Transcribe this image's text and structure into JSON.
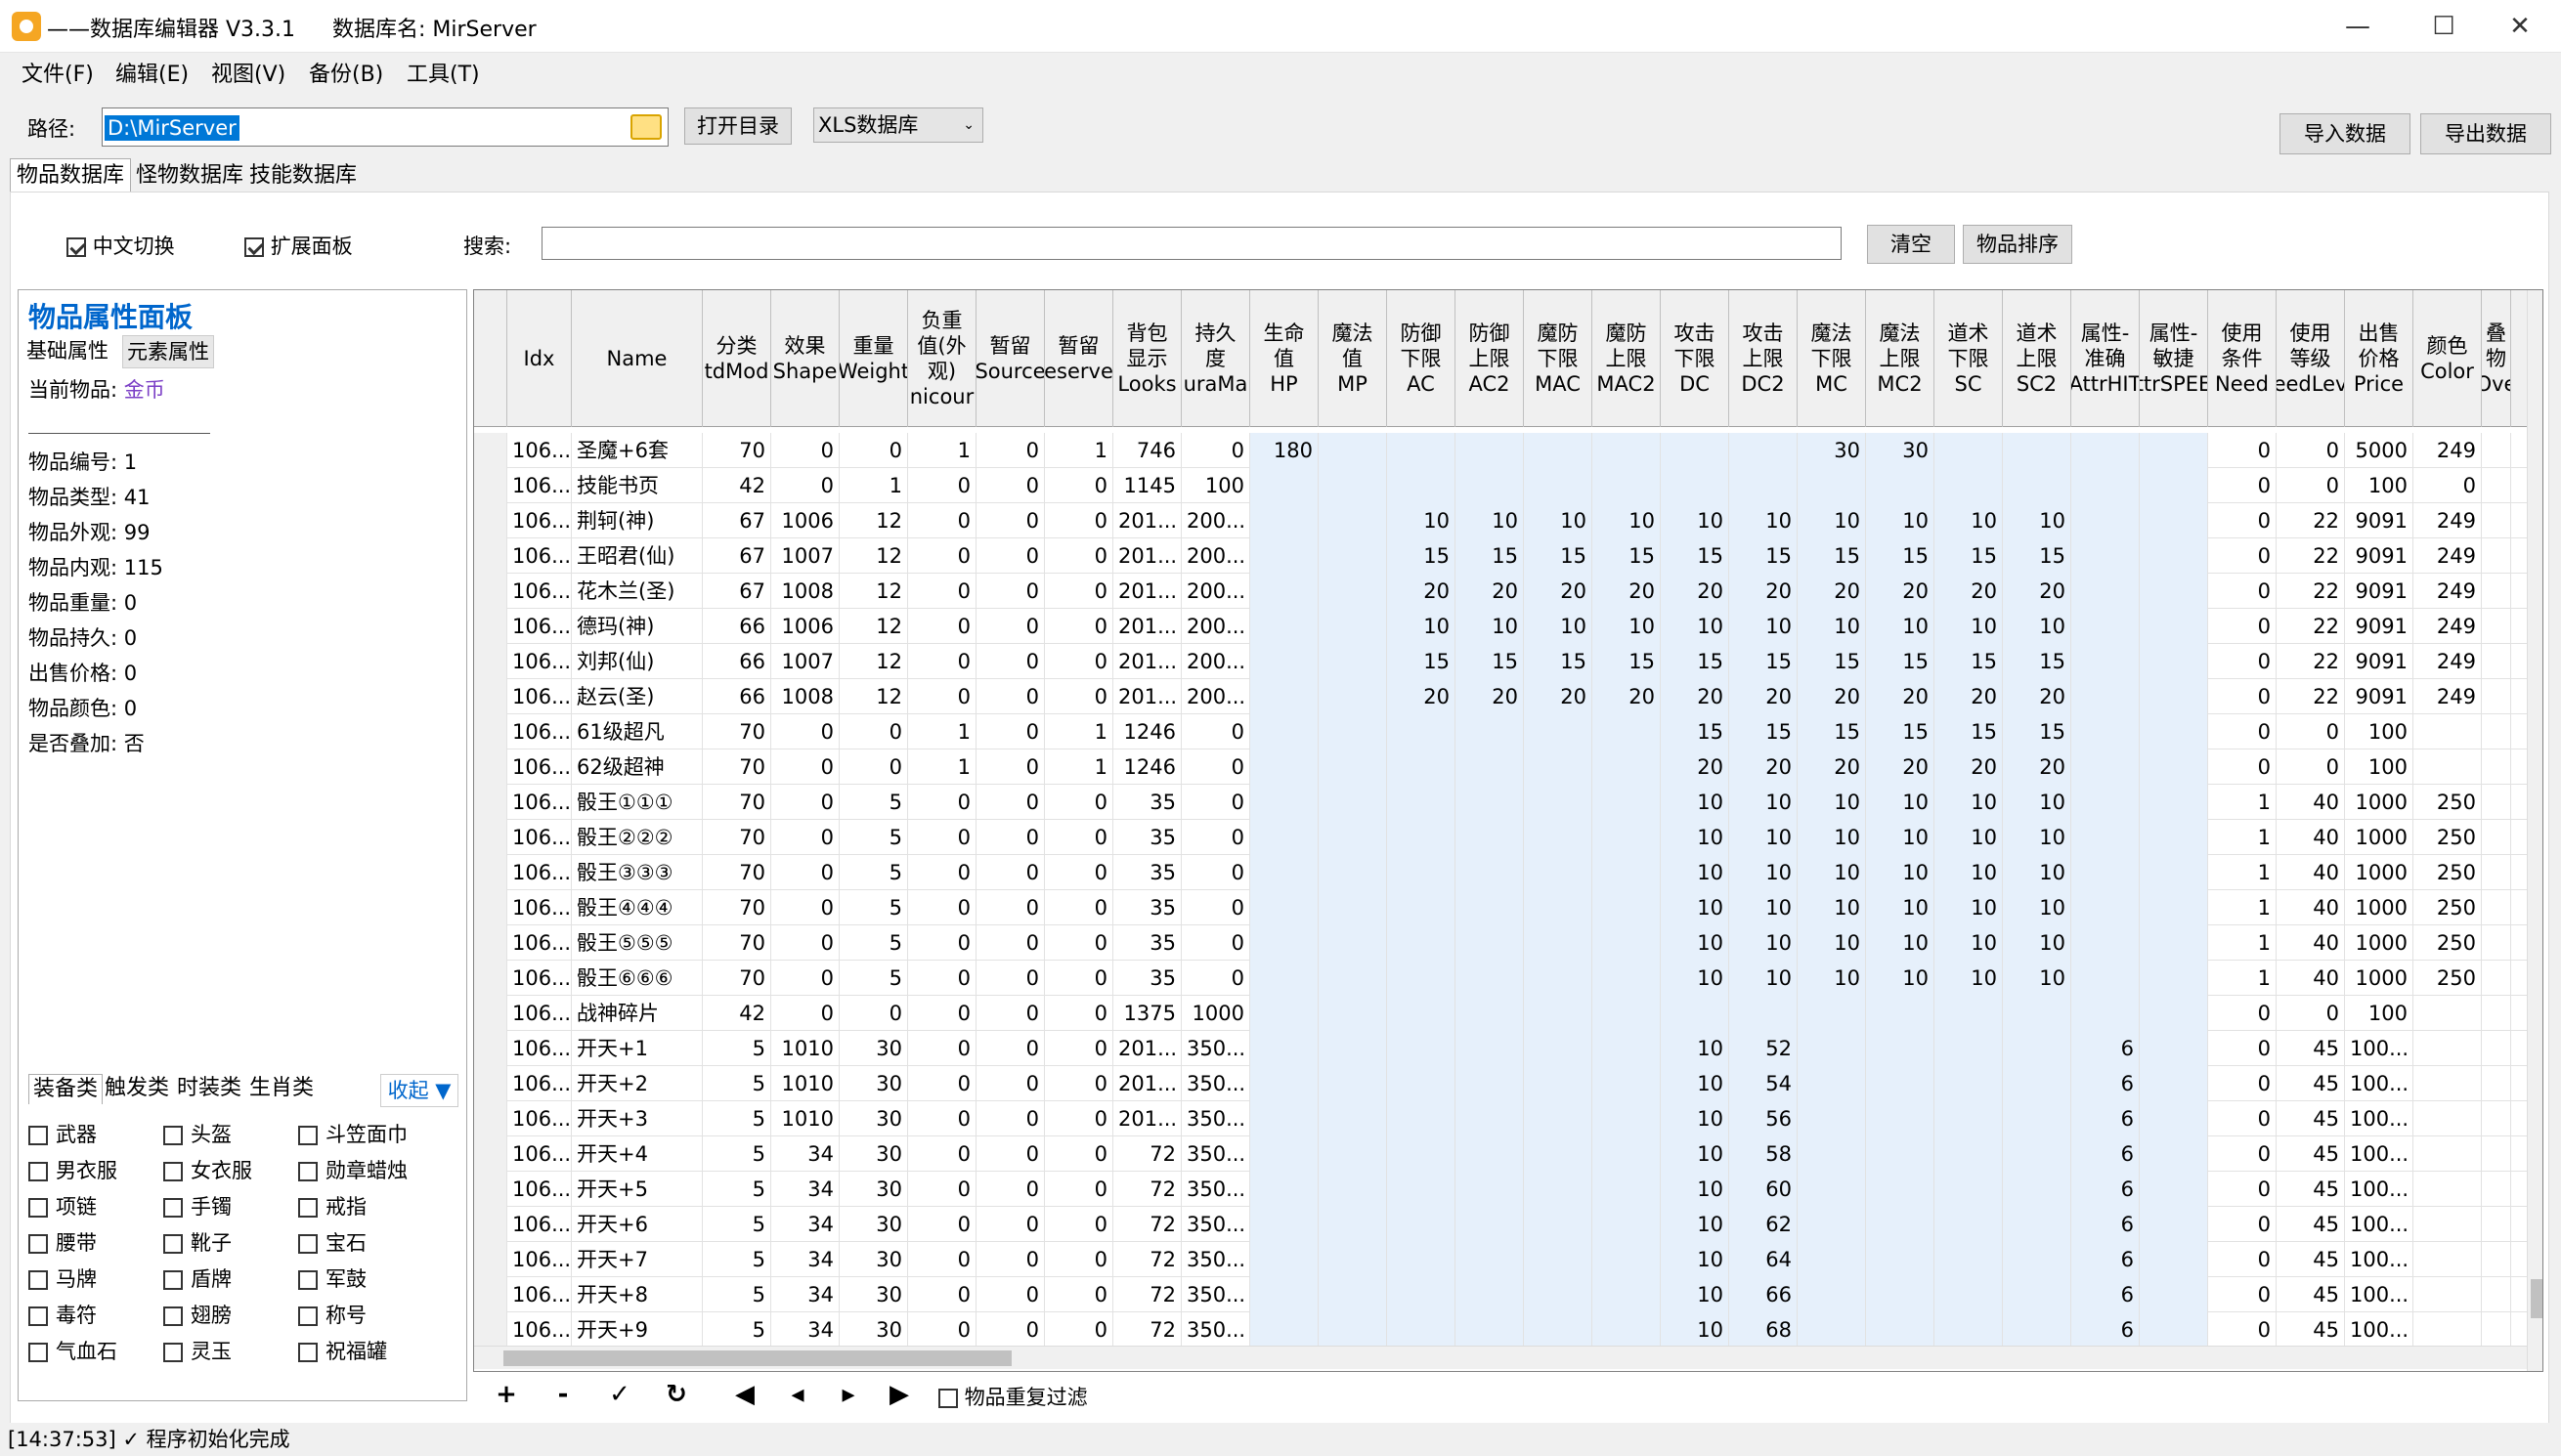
{
  "window": {
    "title": "——数据库编辑器 V3.3.1",
    "db_label": "数据库名: MirServer",
    "minimize": "—",
    "maximize": "☐",
    "close": "✕"
  },
  "menu": [
    "文件(F)",
    "编辑(E)",
    "视图(V)",
    "备份(B)",
    "工具(T)"
  ],
  "toolbar": {
    "path_label": "路径:",
    "path_value": "D:\\MirServer",
    "open_dir": "打开目录",
    "db_type": "XLS数据库",
    "import": "导入数据",
    "export": "导出数据"
  },
  "tabs": [
    "物品数据库",
    "怪物数据库",
    "技能数据库"
  ],
  "options": {
    "chinese_switch": "中文切换",
    "expand_panel": "扩展面板",
    "search_label": "搜索:",
    "search_value": "",
    "clear": "清空",
    "sort": "物品排序"
  },
  "panel": {
    "title": "物品属性面板",
    "subtab_basic": "基础属性",
    "subtab_element": "元素属性",
    "current_label": "当前物品:",
    "current_value": "金币",
    "props": [
      "物品编号: 1",
      "物品类型: 41",
      "物品外观: 99",
      "物品内观: 115",
      "物品重量: 0",
      "物品持久: 0",
      "出售价格: 0",
      "物品颜色: 0",
      "是否叠加: 否"
    ]
  },
  "categories": {
    "tabs": [
      "装备类",
      "触发类",
      "时装类",
      "生肖类"
    ],
    "collapse": "收起 ▼",
    "items": [
      "武器",
      "头盔",
      "斗笠面巾",
      "男衣服",
      "女衣服",
      "勋章蜡烛",
      "项链",
      "手镯",
      "戒指",
      "腰带",
      "靴子",
      "宝石",
      "马牌",
      "盾牌",
      "军鼓",
      "毒符",
      "翅膀",
      "称号",
      "气血石",
      "灵玉",
      "祝福罐"
    ]
  },
  "grid": {
    "headers": [
      "Idx",
      "Name",
      "分类\ntdMod",
      "效果\nShape",
      "重量\nWeight",
      "负重\n值(外\n观)\nnicour",
      "暂留\nSource",
      "暂留\neserve",
      "背包\n显示\nLooks",
      "持久\n度\nuraMa",
      "生命\n值\nHP",
      "魔法\n值\nMP",
      "防御\n下限\nAC",
      "防御\n上限\nAC2",
      "魔防\n下限\nMAC",
      "魔防\n上限\nMAC2",
      "攻击\n下限\nDC",
      "攻击\n上限\nDC2",
      "魔法\n下限\nMC",
      "魔法\n上限\nMC2",
      "道术\n下限\nSC",
      "道术\n上限\nSC2",
      "属性-\n准确\nAttrHIT",
      "属性-\n敏捷\nttrSPEE",
      "使用\n条件\nNeed",
      "使用\n等级\needLev",
      "出售\n价格\nPrice",
      "颜色\nColor",
      "叠\n物\nOve"
    ],
    "rows": [
      [
        "106...",
        "圣魔+6套",
        "70",
        "0",
        "0",
        "1",
        "0",
        "1",
        "746",
        "0",
        "180",
        "",
        "",
        "",
        "",
        "",
        "",
        "",
        "30",
        "30",
        "",
        "",
        "",
        "",
        "0",
        "0",
        "5000",
        "249",
        ""
      ],
      [
        "106...",
        "技能书页",
        "42",
        "0",
        "1",
        "0",
        "0",
        "0",
        "1145",
        "100",
        "",
        "",
        "",
        "",
        "",
        "",
        "",
        "",
        "",
        "",
        "",
        "",
        "",
        "",
        "0",
        "0",
        "100",
        "0",
        ""
      ],
      [
        "106...",
        "荆轲(神)",
        "67",
        "1006",
        "12",
        "0",
        "0",
        "0",
        "201...",
        "200...",
        "",
        "",
        "10",
        "10",
        "10",
        "10",
        "10",
        "10",
        "10",
        "10",
        "10",
        "10",
        "",
        "",
        "0",
        "22",
        "9091",
        "249",
        ""
      ],
      [
        "106...",
        "王昭君(仙)",
        "67",
        "1007",
        "12",
        "0",
        "0",
        "0",
        "201...",
        "200...",
        "",
        "",
        "15",
        "15",
        "15",
        "15",
        "15",
        "15",
        "15",
        "15",
        "15",
        "15",
        "",
        "",
        "0",
        "22",
        "9091",
        "249",
        ""
      ],
      [
        "106...",
        "花木兰(圣)",
        "67",
        "1008",
        "12",
        "0",
        "0",
        "0",
        "201...",
        "200...",
        "",
        "",
        "20",
        "20",
        "20",
        "20",
        "20",
        "20",
        "20",
        "20",
        "20",
        "20",
        "",
        "",
        "0",
        "22",
        "9091",
        "249",
        ""
      ],
      [
        "106...",
        "德玛(神)",
        "66",
        "1006",
        "12",
        "0",
        "0",
        "0",
        "201...",
        "200...",
        "",
        "",
        "10",
        "10",
        "10",
        "10",
        "10",
        "10",
        "10",
        "10",
        "10",
        "10",
        "",
        "",
        "0",
        "22",
        "9091",
        "249",
        ""
      ],
      [
        "106...",
        "刘邦(仙)",
        "66",
        "1007",
        "12",
        "0",
        "0",
        "0",
        "201...",
        "200...",
        "",
        "",
        "15",
        "15",
        "15",
        "15",
        "15",
        "15",
        "15",
        "15",
        "15",
        "15",
        "",
        "",
        "0",
        "22",
        "9091",
        "249",
        ""
      ],
      [
        "106...",
        "赵云(圣)",
        "66",
        "1008",
        "12",
        "0",
        "0",
        "0",
        "201...",
        "200...",
        "",
        "",
        "20",
        "20",
        "20",
        "20",
        "20",
        "20",
        "20",
        "20",
        "20",
        "20",
        "",
        "",
        "0",
        "22",
        "9091",
        "249",
        ""
      ],
      [
        "106...",
        "61级超凡",
        "70",
        "0",
        "0",
        "1",
        "0",
        "1",
        "1246",
        "0",
        "",
        "",
        "",
        "",
        "",
        "",
        "15",
        "15",
        "15",
        "15",
        "15",
        "15",
        "",
        "",
        "0",
        "0",
        "100",
        "",
        ""
      ],
      [
        "106...",
        "62级超神",
        "70",
        "0",
        "0",
        "1",
        "0",
        "1",
        "1246",
        "0",
        "",
        "",
        "",
        "",
        "",
        "",
        "20",
        "20",
        "20",
        "20",
        "20",
        "20",
        "",
        "",
        "0",
        "0",
        "100",
        "",
        ""
      ],
      [
        "106...",
        "骰王①①①",
        "70",
        "0",
        "5",
        "0",
        "0",
        "0",
        "35",
        "0",
        "",
        "",
        "",
        "",
        "",
        "",
        "10",
        "10",
        "10",
        "10",
        "10",
        "10",
        "",
        "",
        "1",
        "40",
        "1000",
        "250",
        ""
      ],
      [
        "106...",
        "骰王②②②",
        "70",
        "0",
        "5",
        "0",
        "0",
        "0",
        "35",
        "0",
        "",
        "",
        "",
        "",
        "",
        "",
        "10",
        "10",
        "10",
        "10",
        "10",
        "10",
        "",
        "",
        "1",
        "40",
        "1000",
        "250",
        ""
      ],
      [
        "106...",
        "骰王③③③",
        "70",
        "0",
        "5",
        "0",
        "0",
        "0",
        "35",
        "0",
        "",
        "",
        "",
        "",
        "",
        "",
        "10",
        "10",
        "10",
        "10",
        "10",
        "10",
        "",
        "",
        "1",
        "40",
        "1000",
        "250",
        ""
      ],
      [
        "106...",
        "骰王④④④",
        "70",
        "0",
        "5",
        "0",
        "0",
        "0",
        "35",
        "0",
        "",
        "",
        "",
        "",
        "",
        "",
        "10",
        "10",
        "10",
        "10",
        "10",
        "10",
        "",
        "",
        "1",
        "40",
        "1000",
        "250",
        ""
      ],
      [
        "106...",
        "骰王⑤⑤⑤",
        "70",
        "0",
        "5",
        "0",
        "0",
        "0",
        "35",
        "0",
        "",
        "",
        "",
        "",
        "",
        "",
        "10",
        "10",
        "10",
        "10",
        "10",
        "10",
        "",
        "",
        "1",
        "40",
        "1000",
        "250",
        ""
      ],
      [
        "106...",
        "骰王⑥⑥⑥",
        "70",
        "0",
        "5",
        "0",
        "0",
        "0",
        "35",
        "0",
        "",
        "",
        "",
        "",
        "",
        "",
        "10",
        "10",
        "10",
        "10",
        "10",
        "10",
        "",
        "",
        "1",
        "40",
        "1000",
        "250",
        ""
      ],
      [
        "106...",
        "战神碎片",
        "42",
        "0",
        "0",
        "0",
        "0",
        "0",
        "1375",
        "1000",
        "",
        "",
        "",
        "",
        "",
        "",
        "",
        "",
        "",
        "",
        "",
        "",
        "",
        "",
        "0",
        "0",
        "100",
        "",
        ""
      ],
      [
        "106...",
        "开天+1",
        "5",
        "1010",
        "30",
        "0",
        "0",
        "0",
        "201...",
        "350...",
        "",
        "",
        "",
        "",
        "",
        "",
        "10",
        "52",
        "",
        "",
        "",
        "",
        "6",
        "",
        "0",
        "45",
        "100...",
        "",
        ""
      ],
      [
        "106...",
        "开天+2",
        "5",
        "1010",
        "30",
        "0",
        "0",
        "0",
        "201...",
        "350...",
        "",
        "",
        "",
        "",
        "",
        "",
        "10",
        "54",
        "",
        "",
        "",
        "",
        "6",
        "",
        "0",
        "45",
        "100...",
        "",
        ""
      ],
      [
        "106...",
        "开天+3",
        "5",
        "1010",
        "30",
        "0",
        "0",
        "0",
        "201...",
        "350...",
        "",
        "",
        "",
        "",
        "",
        "",
        "10",
        "56",
        "",
        "",
        "",
        "",
        "6",
        "",
        "0",
        "45",
        "100...",
        "",
        ""
      ],
      [
        "106...",
        "开天+4",
        "5",
        "34",
        "30",
        "0",
        "0",
        "0",
        "72",
        "350...",
        "",
        "",
        "",
        "",
        "",
        "",
        "10",
        "58",
        "",
        "",
        "",
        "",
        "6",
        "",
        "0",
        "45",
        "100...",
        "",
        ""
      ],
      [
        "106...",
        "开天+5",
        "5",
        "34",
        "30",
        "0",
        "0",
        "0",
        "72",
        "350...",
        "",
        "",
        "",
        "",
        "",
        "",
        "10",
        "60",
        "",
        "",
        "",
        "",
        "6",
        "",
        "0",
        "45",
        "100...",
        "",
        ""
      ],
      [
        "106...",
        "开天+6",
        "5",
        "34",
        "30",
        "0",
        "0",
        "0",
        "72",
        "350...",
        "",
        "",
        "",
        "",
        "",
        "",
        "10",
        "62",
        "",
        "",
        "",
        "",
        "6",
        "",
        "0",
        "45",
        "100...",
        "",
        ""
      ],
      [
        "106...",
        "开天+7",
        "5",
        "34",
        "30",
        "0",
        "0",
        "0",
        "72",
        "350...",
        "",
        "",
        "",
        "",
        "",
        "",
        "10",
        "64",
        "",
        "",
        "",
        "",
        "6",
        "",
        "0",
        "45",
        "100...",
        "",
        ""
      ],
      [
        "106...",
        "开天+8",
        "5",
        "34",
        "30",
        "0",
        "0",
        "0",
        "72",
        "350...",
        "",
        "",
        "",
        "",
        "",
        "",
        "10",
        "66",
        "",
        "",
        "",
        "",
        "6",
        "",
        "0",
        "45",
        "100...",
        "",
        ""
      ],
      [
        "106...",
        "开天+9",
        "5",
        "34",
        "30",
        "0",
        "0",
        "0",
        "72",
        "350...",
        "",
        "",
        "",
        "",
        "",
        "",
        "10",
        "68",
        "",
        "",
        "",
        "",
        "6",
        "",
        "0",
        "45",
        "100...",
        "",
        ""
      ]
    ]
  },
  "bottom": {
    "buttons": [
      "+",
      "-",
      "✓",
      "↻",
      "◀",
      "◂",
      "▸",
      "▶"
    ],
    "dup_filter": "物品重复过滤"
  },
  "status": "[14:37:53] ✓ 程序初始化完成"
}
